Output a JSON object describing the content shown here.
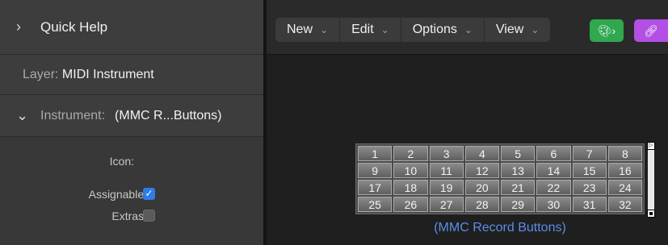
{
  "inspector": {
    "quick_help": "Quick Help",
    "layer_prefix": "Layer:",
    "layer_value": "MIDI Instrument",
    "instrument_prefix": "Instrument:",
    "instrument_value": "(MMC R...Buttons)",
    "icon_label": "Icon:",
    "assignable_label": "Assignable:",
    "assignable_checked": true,
    "extras_label": "Extras:",
    "extras_checked": false
  },
  "toolbar": {
    "menus": [
      "New",
      "Edit",
      "Options",
      "View"
    ],
    "green_tool": "palette-midi-thru-button",
    "purple_tool": "link-button",
    "accent_green": "#2fa84f",
    "accent_purple": "#b24fe4"
  },
  "mmc": {
    "buttons": [
      "1",
      "2",
      "3",
      "4",
      "5",
      "6",
      "7",
      "8",
      "9",
      "10",
      "11",
      "12",
      "13",
      "14",
      "15",
      "16",
      "17",
      "18",
      "19",
      "20",
      "21",
      "22",
      "23",
      "24",
      "25",
      "26",
      "27",
      "28",
      "29",
      "30",
      "31",
      "32"
    ],
    "caption": "(MMC Record Buttons)",
    "caption_color": "#5a8dea"
  }
}
